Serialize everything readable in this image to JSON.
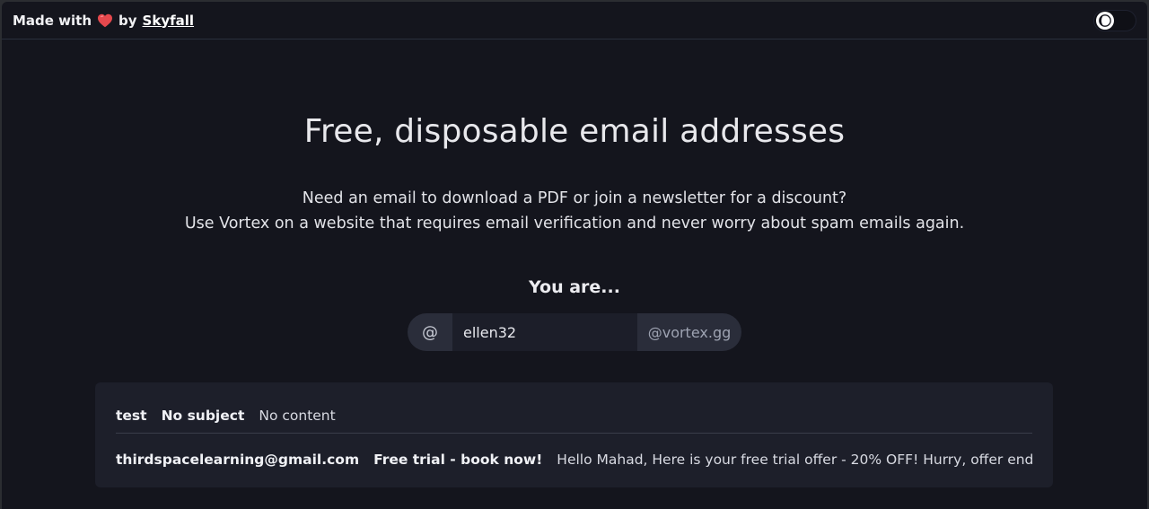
{
  "topbar": {
    "made_with": "Made with",
    "by": "by",
    "author": "Skyfall",
    "heart_icon": "heart-icon",
    "theme_icon": "moon-icon"
  },
  "hero": {
    "title": "Free, disposable email addresses",
    "line1": "Need an email to download a PDF or join a newsletter for a discount?",
    "line2": "Use Vortex on a website that requires email verification and never worry about spam emails again.",
    "you_are": "You are..."
  },
  "address": {
    "at_symbol": "@",
    "username": "ellen32",
    "domain": "@vortex.gg"
  },
  "inbox": {
    "emails": [
      {
        "from": "test",
        "subject": "No subject",
        "content": "No content"
      },
      {
        "from": "thirdspacelearning@gmail.com",
        "subject": "Free trial - book now!",
        "content": "Hello Mahad, Here is your free trial offer - 20% OFF! Hurry, offer ends Saturday. - Max"
      }
    ]
  },
  "colors": {
    "background": "#14151d",
    "panel": "#1d1f2a",
    "heart": "#e5484d"
  }
}
